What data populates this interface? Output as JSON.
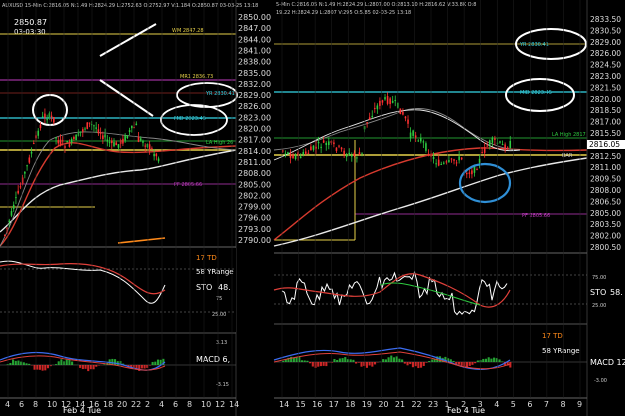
{
  "left_chart": {
    "header": "AUXUSD 15-Min  C:2816.05  N:1.49  H:2824.29  L:2752.63  O:2752.97  V:1.184  O:2850.87 03-03-25 13:18",
    "last_label": "2850.87",
    "time_label": "03-03:30",
    "levels": {
      "wm": "WM 2847.28",
      "mr1": "MR1 2836.73",
      "yr": "YR 2830.41",
      "mid": "MID 2823.45",
      "la": "LA High 26",
      "pf": "PF 2805.66"
    },
    "x_ticks": [
      "4",
      "6",
      "8",
      "10",
      "12",
      "14",
      "16",
      "18",
      "20",
      "22",
      "2",
      "4",
      "6",
      "8",
      "10",
      "12",
      "14"
    ],
    "date_label": "Feb 4 Tue",
    "stoch": {
      "td": "17 TD",
      "yrange": "58 YRange",
      "label": "STO",
      "value": "48.",
      "lvl75": "75",
      "lvl25": "25.00"
    },
    "macd": {
      "label": "MACD 6,",
      "top": "3.13",
      "bottom": "-3.15"
    }
  },
  "right_chart": {
    "header": "5-Min  C:2816.05  N:1.49  H:2824.29  L:2807.00  O:2813.10  H:2816.62  V:33.8K  O:8",
    "sub_header": "19.22  H:2824.29  L:2807  V:295  O:5.85  02-03-25  13:18",
    "levels": {
      "yr": "YR 2830.41",
      "mid": "MID 2823.45",
      "la": "LA High 2817",
      "bar": "BAR",
      "pf": "PF 2805.66"
    },
    "price_axis": [
      "2850.00",
      "2847.00",
      "2844.00",
      "2841.00",
      "2838.00",
      "2835.00",
      "2832.00",
      "2829.00",
      "2826.00",
      "2823.00",
      "2820.00",
      "2817.00",
      "2814.00",
      "2811.00",
      "2808.00",
      "2805.00",
      "2802.00",
      "2799.00",
      "2796.00",
      "2793.00",
      "2790.00"
    ],
    "right_axis": [
      "2833.50",
      "2830.50",
      "2829.00",
      "2826.00",
      "2824.50",
      "2823.00",
      "2821.50",
      "2820.00",
      "2818.50",
      "2817.00",
      "2815.50",
      "2814.00",
      "2812.50",
      "2811.00",
      "2809.50",
      "2808.00",
      "2806.50",
      "2805.00",
      "2803.50",
      "2802.00",
      "2800.50"
    ],
    "current_price": "2816.05",
    "x_ticks": [
      "14",
      "15",
      "16",
      "17",
      "18",
      "19",
      "20",
      "21",
      "22",
      "23",
      "1",
      "2",
      "3",
      "4",
      "5",
      "6",
      "7",
      "8",
      "9"
    ],
    "date_label": "Feb 4 Tue",
    "stoch": {
      "label": "STO",
      "value": "58.",
      "lvl75": "75.00",
      "lvl25": "25.00"
    },
    "macd": {
      "td": "17 TD",
      "yrange": "58 YRange",
      "label": "MACD 12",
      "bottom": "-3.00"
    }
  },
  "colors": {
    "background": "#000000",
    "candle_up": "#2ecc40",
    "candle_down": "#ff3030",
    "level_yellow": "#e8d24a",
    "level_cyan": "#35d6e6",
    "level_red": "#e0403a",
    "level_magenta": "#c23cc2",
    "ma_white": "#e8e8e8",
    "ma_red": "#d63a2e",
    "annotation_blue": "#2f8fd6",
    "orange": "#ff8a1a"
  }
}
